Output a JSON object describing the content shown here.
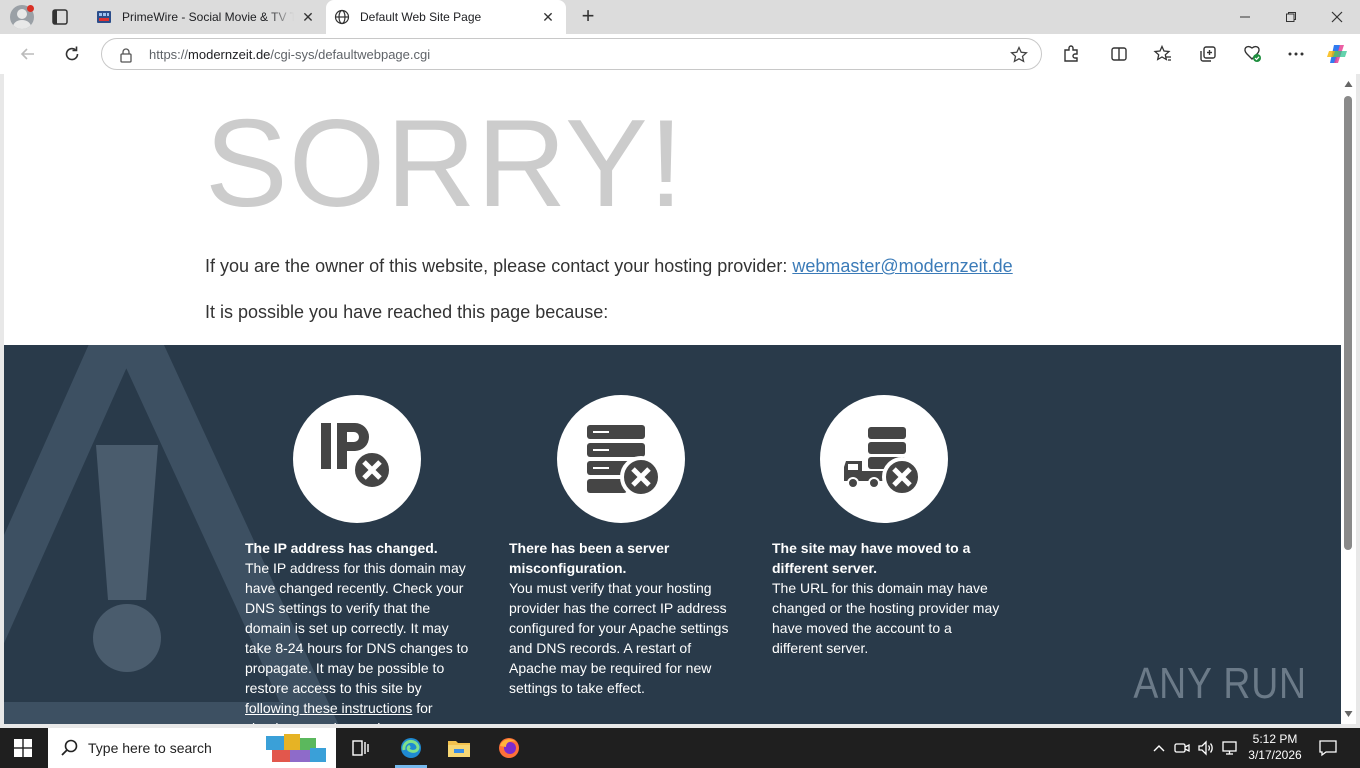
{
  "browser": {
    "tabs": [
      {
        "title": "PrimeWire - Social Movie & TV Trackers",
        "active": false
      },
      {
        "title": "Default Web Site Page",
        "active": true
      }
    ],
    "address": {
      "scheme": "https://",
      "host": "modernzeit.de",
      "path": "/cgi-sys/defaultwebpage.cgi"
    }
  },
  "page": {
    "headline": "SORRY!",
    "owner_text": "If you are the owner of this website, please contact your hosting provider: ",
    "owner_email": "webmaster@modernzeit.de",
    "reason_intro": "It is possible you have reached this page because:",
    "reasons": [
      {
        "icon": "ip-error-icon",
        "heading": "The IP address has changed.",
        "body": "The IP address for this domain may have changed recently. Check your DNS settings to verify that the domain is set up correctly. It may take 8-24 hours for DNS changes to propagate. It may be possible to restore access to this site by ",
        "link": "following these instructions",
        "body_after": " for clearing your dns cache."
      },
      {
        "icon": "server-error-icon",
        "heading": "There has been a server misconfiguration.",
        "body": "You must verify that your hosting provider has the correct IP address configured for your Apache settings and DNS records. A restart of Apache may be required for new settings to take effect."
      },
      {
        "icon": "server-moved-icon",
        "heading": "The site may have moved to a different server.",
        "body": "The URL for this domain may have changed or the hosting provider may have moved the account to a different server."
      }
    ],
    "watermark": "ANY RUN"
  },
  "taskbar": {
    "search_placeholder": "Type here to search",
    "time": "5:12 PM",
    "date": "3/17/2026"
  },
  "colors": {
    "dark_panel": "#293a4a",
    "headline": "#cccccc",
    "link": "#3b7bb8",
    "taskbar": "#1f1f1f"
  }
}
